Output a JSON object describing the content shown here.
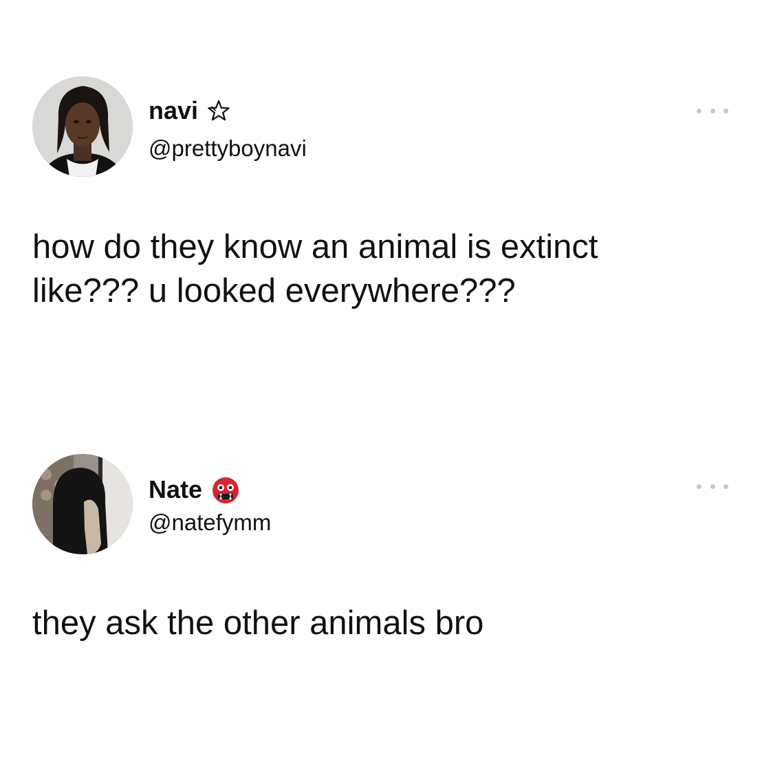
{
  "tweets": [
    {
      "display_name": "navi",
      "name_icon": "star-outline-icon",
      "handle": "@prettyboynavi",
      "text": "how do they know an animal is extinct\nlike??? u looked everywhere???",
      "menu_icon": "more-options-icon"
    },
    {
      "display_name": "Nate",
      "name_icon": "ogre-emoji-icon",
      "handle": "@natefymm",
      "text": "they ask the other animals bro",
      "menu_icon": "more-options-icon"
    }
  ],
  "colors": {
    "text": "#111111",
    "menu_dots": "#c5c9cd",
    "ogre": "#d9232d"
  }
}
